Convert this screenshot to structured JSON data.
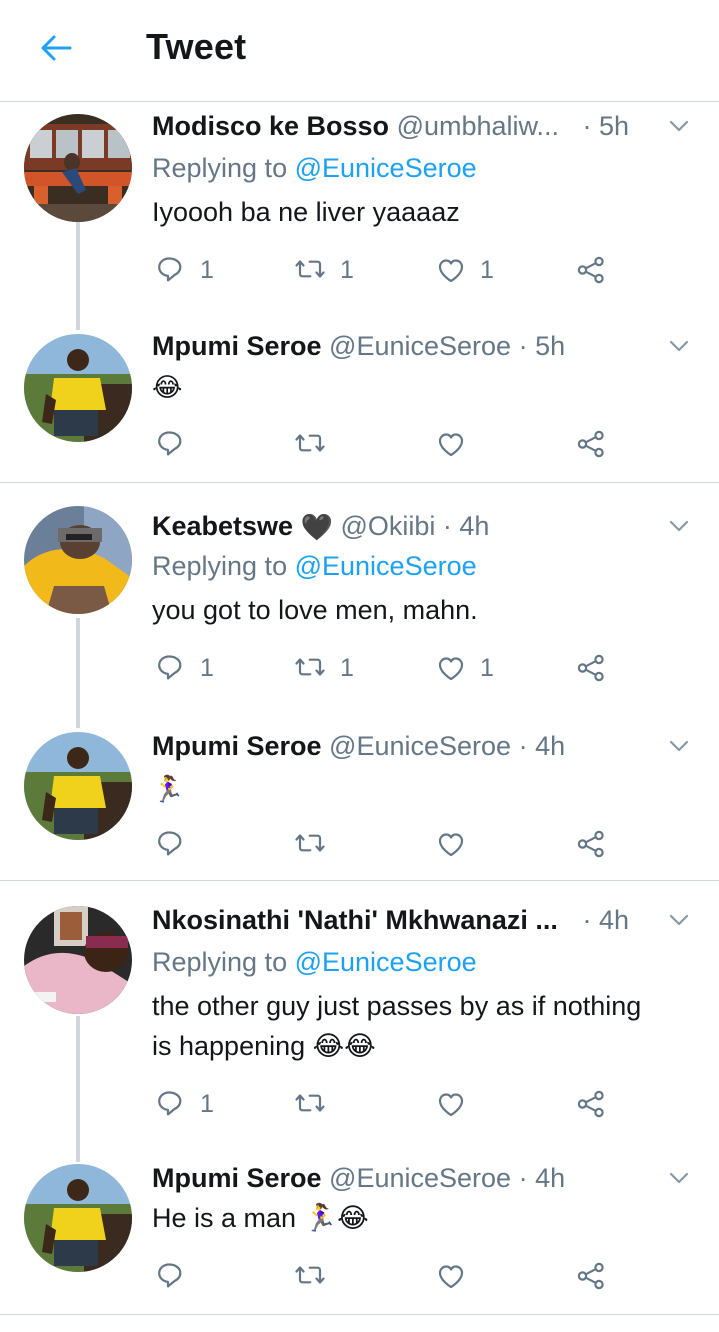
{
  "header": {
    "title": "Tweet"
  },
  "threads": [
    {
      "reply": {
        "name": "Modisco ke Bosso",
        "handle": "@umbhaliw...",
        "time": "· 5h",
        "replying_prefix": "Replying to",
        "replying_to": "@EuniceSeroe",
        "text": "Iyoooh ba ne liver yaaaaz",
        "reply_count": "1",
        "retweet_count": "1",
        "like_count": "1"
      },
      "author_reply": {
        "name": "Mpumi Seroe",
        "handle": "@EuniceSeroe",
        "time": "· 5h",
        "text": "😂"
      }
    },
    {
      "reply": {
        "name": "Keabetswe",
        "name_suffix": "🖤",
        "handle": "@Okiibi",
        "time": "· 4h",
        "replying_prefix": "Replying to",
        "replying_to": "@EuniceSeroe",
        "text": "you got to love men, mahn.",
        "reply_count": "1",
        "retweet_count": "1",
        "like_count": "1"
      },
      "author_reply": {
        "name": "Mpumi Seroe",
        "handle": "@EuniceSeroe",
        "time": "· 4h",
        "text": "🏃‍♀️"
      }
    },
    {
      "reply": {
        "name": "Nkosinathi 'Nathi' Mkhwanazi ...",
        "handle": "",
        "time": "· 4h",
        "replying_prefix": "Replying to",
        "replying_to": "@EuniceSeroe",
        "text_line1": "the other guy just passes by as if nothing",
        "text_line2": "is happening 😂😂",
        "reply_count": "1"
      },
      "author_reply": {
        "name": "Mpumi Seroe",
        "handle": "@EuniceSeroe",
        "time": "· 4h",
        "text": "He is a man 🏃‍♀️😂"
      }
    }
  ],
  "colors": {
    "accent": "#1da1f2",
    "secondary_text": "#657786",
    "divider": "#cfd6dc"
  },
  "icons": [
    "back-arrow-icon",
    "chevron-down-icon",
    "reply-icon",
    "retweet-icon",
    "like-icon",
    "share-icon"
  ]
}
